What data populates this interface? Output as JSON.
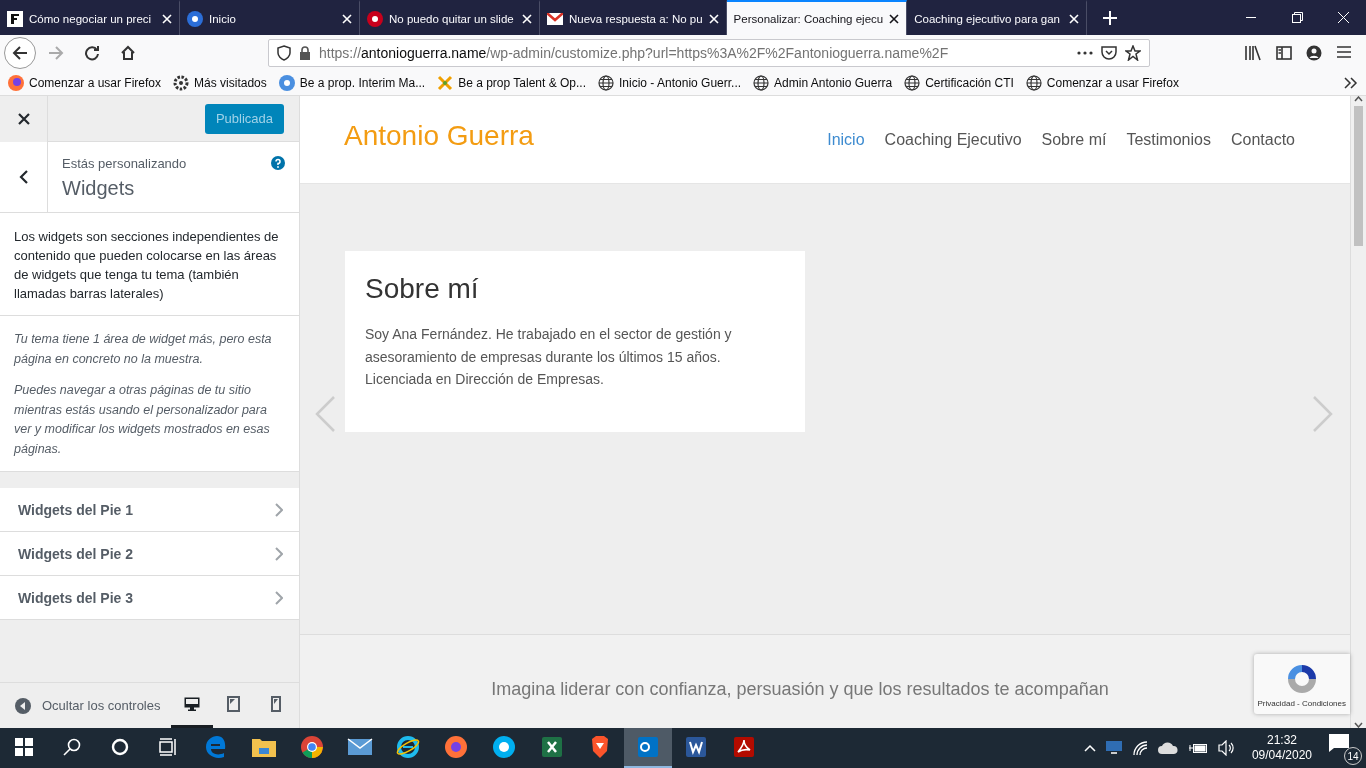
{
  "browser": {
    "tabs": [
      {
        "title": "Cómo negociar un preci",
        "selected": false
      },
      {
        "title": "Inicio",
        "selected": false
      },
      {
        "title": "No puedo quitar un slide",
        "selected": false
      },
      {
        "title": "Nueva respuesta a: No pu",
        "selected": false
      },
      {
        "title": "Personalizar: Coaching ejecu",
        "selected": true
      },
      {
        "title": "Coaching ejecutivo para gan",
        "selected": false
      }
    ],
    "url": {
      "prefix": "https://",
      "domain": "antonioguerra.name",
      "path": "/wp-admin/customize.php?url=https%3A%2F%2Fantonioguerra.name%2F"
    },
    "bookmarks": [
      {
        "label": "Comenzar a usar Firefox"
      },
      {
        "label": "Más visitados"
      },
      {
        "label": "Be a prop. Interim Ma..."
      },
      {
        "label": "Be a prop Talent & Op..."
      },
      {
        "label": "Inicio - Antonio Guerr..."
      },
      {
        "label": "Admin Antonio Guerra"
      },
      {
        "label": "Certificación CTI"
      },
      {
        "label": "Comenzar a usar Firefox"
      }
    ]
  },
  "customizer": {
    "publish_button": "Publicada",
    "context_label": "Estás personalizando",
    "section_title": "Widgets",
    "description": "Los widgets son secciones independientes de contenido que pueden colocarse en las áreas de widgets que tenga tu tema (también llamadas barras laterales)",
    "notices": [
      "Tu tema tiene 1 área de widget más, pero esta página en concreto no la muestra.",
      "Puedes navegar a otras páginas de tu sitio mientras estás usando el personalizador para ver y modificar los widgets mostrados en esas páginas."
    ],
    "areas": [
      {
        "label": "Widgets del Pie 1"
      },
      {
        "label": "Widgets del Pie 2"
      },
      {
        "label": "Widgets del Pie 3"
      }
    ],
    "hide_controls": "Ocultar los controles",
    "devices": [
      {
        "kind": "desktop",
        "selected": true
      },
      {
        "kind": "tablet",
        "selected": false
      },
      {
        "kind": "mobile",
        "selected": false
      }
    ]
  },
  "preview": {
    "site_title": "Antonio Guerra",
    "menu": [
      {
        "label": "Inicio",
        "selected": true
      },
      {
        "label": "Coaching Ejecutivo",
        "selected": false
      },
      {
        "label": "Sobre mí",
        "selected": false
      },
      {
        "label": "Testimonios",
        "selected": false
      },
      {
        "label": "Contacto",
        "selected": false
      }
    ],
    "slide": {
      "title": "Sobre mí",
      "text": "Soy Ana Fernández. He trabajado en el sector de gestión y asesoramiento de empresas durante los últimos 15 años. Licenciada en Dirección de Empresas."
    },
    "tagline": "Imagina liderar con confianza, persuasión y que los resultados te acompañan",
    "recaptcha": "Privacidad - Condiciones"
  },
  "taskbar": {
    "apps": [
      {
        "kind": "edge",
        "active": false
      },
      {
        "kind": "folder",
        "active": false
      },
      {
        "kind": "chrome",
        "active": false
      },
      {
        "kind": "mail",
        "active": false
      },
      {
        "kind": "ie",
        "active": false
      },
      {
        "kind": "firefox",
        "active": false
      },
      {
        "kind": "skype",
        "active": false
      },
      {
        "kind": "excel",
        "active": false
      },
      {
        "kind": "brave",
        "active": false
      },
      {
        "kind": "outlook",
        "active": true
      },
      {
        "kind": "word",
        "active": false
      },
      {
        "kind": "acrobat",
        "active": false
      }
    ],
    "time": "21:32",
    "date": "09/04/2020",
    "notifications": "14"
  }
}
